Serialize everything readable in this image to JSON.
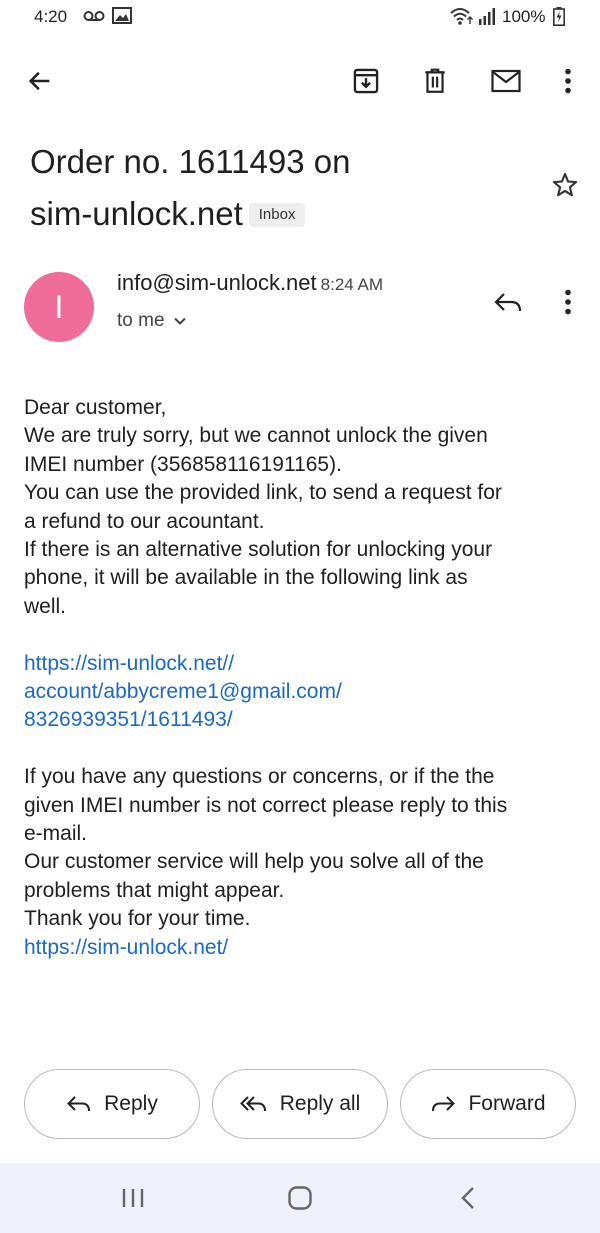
{
  "status_bar": {
    "time": "4:20",
    "battery": "100%"
  },
  "email": {
    "subject_line1": "Order no. 1611493 on",
    "subject_line2": "sim-unlock.net",
    "label": "Inbox",
    "avatar_initial": "I",
    "sender": "info@sim-unlock.net",
    "time": "8:24 AM",
    "recipient": "to me",
    "body": {
      "p1": [
        "Dear customer,",
        "We are truly sorry, but we cannot unlock the given",
        "IMEI number (356858116191165).",
        "You can use the provided link, to send a request for",
        "a refund to our acountant.",
        "If there is an alternative solution for unlocking your",
        "phone, it will be available in the following link as",
        "well."
      ],
      "link_lines": [
        "https://sim-unlock.net//",
        "account/abbycreme1@gmail.com/",
        "8326939351/1611493/"
      ],
      "p2": [
        "If you have any questions or concerns, or if the the",
        "given IMEI number is not correct please reply to this",
        "e-mail.",
        "Our customer service will help you solve all of the",
        "problems that might appear.",
        "Thank you for your time."
      ],
      "final_link": "https://sim-unlock.net/"
    }
  },
  "actions": {
    "reply": "Reply",
    "reply_all": "Reply all",
    "forward": "Forward"
  },
  "colors": {
    "avatar": "#ef6d98",
    "link": "#1a68c7",
    "nav_bar": "#f0f2fb"
  },
  "icons": [
    "back-arrow-icon",
    "archive-icon",
    "trash-icon",
    "mail-icon",
    "more-vert-icon",
    "star-icon",
    "reply-icon",
    "reply-all-icon",
    "forward-icon"
  ]
}
